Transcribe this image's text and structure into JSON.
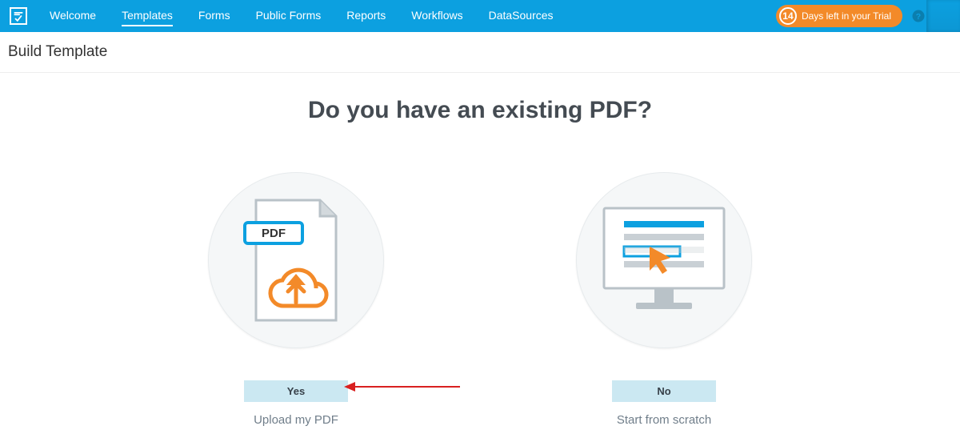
{
  "header": {
    "nav": [
      "Welcome",
      "Templates",
      "Forms",
      "Public Forms",
      "Reports",
      "Workflows",
      "DataSources"
    ],
    "active_index": 1,
    "trial": {
      "days": "14",
      "label": "Days left in your Trial"
    }
  },
  "subheader": {
    "title": "Build Template"
  },
  "main": {
    "title": "Do you have an existing PDF?",
    "options": [
      {
        "button": "Yes",
        "caption": "Upload my PDF",
        "badge": "PDF"
      },
      {
        "button": "No",
        "caption": "Start from scratch"
      }
    ]
  }
}
